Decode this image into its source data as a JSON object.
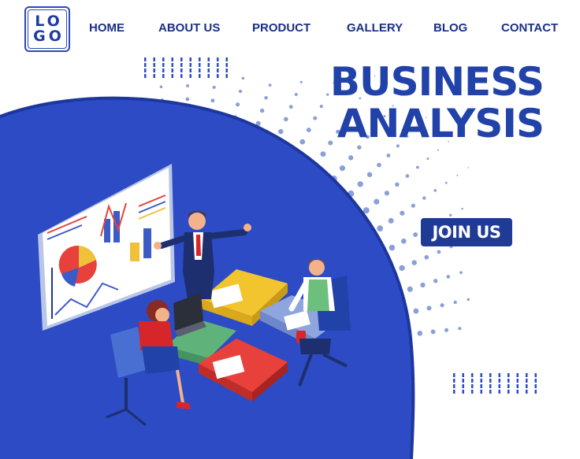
{
  "logo": {
    "line1": "LO",
    "line2": "GO"
  },
  "nav": {
    "items": [
      {
        "label": "HOME"
      },
      {
        "label": "ABOUT US"
      },
      {
        "label": "PRODUCT"
      },
      {
        "label": "GALLERY"
      },
      {
        "label": "BLOG"
      },
      {
        "label": "CONTACT"
      }
    ]
  },
  "hero": {
    "title_line1": "BUSINESS",
    "title_line2": "ANALYSIS",
    "cta_label": "JOIN US",
    "illustration": "business-meeting-puzzle-illustration"
  },
  "colors": {
    "brand_blue": "#2142a8",
    "nav_text": "#1a2f86",
    "hero_circle": "#2c4bc4",
    "cta_bg": "#1f3b95",
    "dots": "#8aa0d6"
  }
}
